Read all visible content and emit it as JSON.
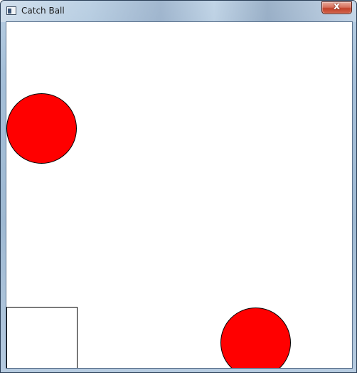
{
  "window": {
    "title": "Catch Ball",
    "close_label": "x"
  },
  "game": {
    "ball_color": "#ff0000",
    "catcher_color": "#ffffff",
    "background_color": "#ffffff",
    "balls": [
      {
        "name": "ball-1"
      },
      {
        "name": "ball-2"
      }
    ]
  }
}
